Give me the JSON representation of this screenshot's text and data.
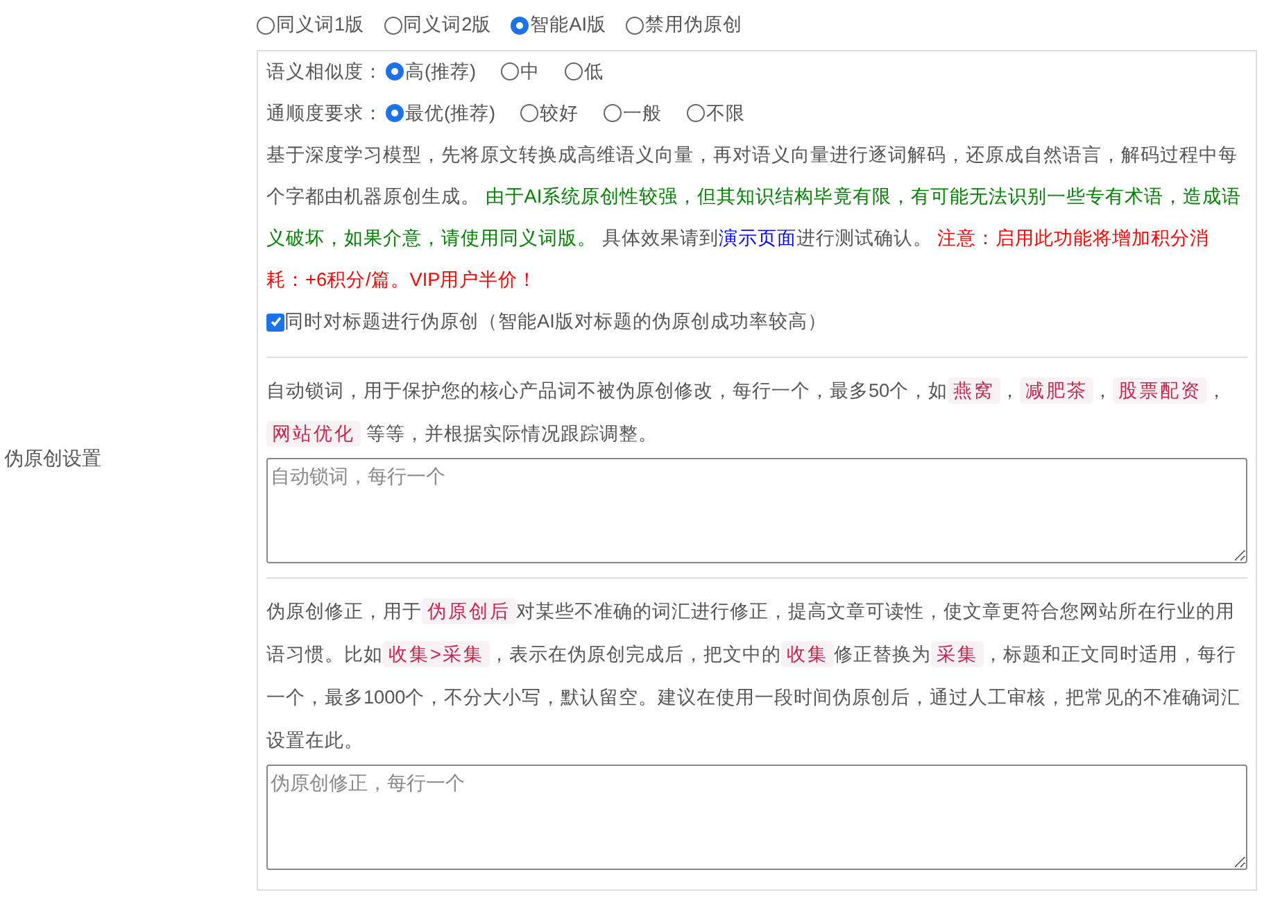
{
  "side_label": "伪原创设置",
  "modes": [
    {
      "label": "同义词1版",
      "selected": false
    },
    {
      "label": "同义词2版",
      "selected": false
    },
    {
      "label": "智能AI版",
      "selected": true
    },
    {
      "label": "禁用伪原创",
      "selected": false
    }
  ],
  "option_groups": [
    {
      "label": "语义相似度：",
      "options": [
        {
          "label": "高(推荐)",
          "selected": true
        },
        {
          "label": "中",
          "selected": false
        },
        {
          "label": "低",
          "selected": false
        }
      ]
    },
    {
      "label": "通顺度要求：",
      "options": [
        {
          "label": "最优(推荐)",
          "selected": true
        },
        {
          "label": "较好",
          "selected": false
        },
        {
          "label": "一般",
          "selected": false
        },
        {
          "label": "不限",
          "selected": false
        }
      ]
    }
  ],
  "ai_note": [
    {
      "kind": "text",
      "text": "基于深度学习模型，先将原文转换成高维语义向量，再对语义向量进行逐词解码，还原成自然语言，解码过程中每个字都由机器原创生成。 "
    },
    {
      "kind": "green",
      "text": "由于AI系统原创性较强，但其知识结构毕竟有限，有可能无法识别一些专有术语，造成语义破坏，如果介意，请使用同义词版。"
    },
    {
      "kind": "text",
      "text": " 具体效果请到"
    },
    {
      "kind": "link",
      "text": "演示页面"
    },
    {
      "kind": "text",
      "text": "进行测试确认。 "
    },
    {
      "kind": "red",
      "text": "注意：启用此功能将增加积分消耗：+6积分/篇。VIP用户半价！"
    }
  ],
  "title_option": {
    "label": "同时对标题进行伪原创（智能AI版对标题的伪原创成功率较高）",
    "checked": true
  },
  "sections": [
    {
      "note": [
        {
          "kind": "text",
          "text": "自动锁词，用于保护您的核心产品词不被伪原创修改，每行一个，最多50个，如"
        },
        {
          "kind": "tag",
          "text": "燕窝"
        },
        {
          "kind": "text",
          "text": "，"
        },
        {
          "kind": "tag",
          "text": "减肥茶"
        },
        {
          "kind": "text",
          "text": "，"
        },
        {
          "kind": "tag",
          "text": "股票配资"
        },
        {
          "kind": "text",
          "text": "，"
        },
        {
          "kind": "tag",
          "text": "网站优化"
        },
        {
          "kind": "text",
          "text": " 等等，并根据实际情况跟踪调整。"
        }
      ],
      "placeholder": "自动锁词，每行一个"
    },
    {
      "note": [
        {
          "kind": "text",
          "text": "伪原创修正，用于"
        },
        {
          "kind": "tag",
          "text": "伪原创后"
        },
        {
          "kind": "text",
          "text": "对某些不准确的词汇进行修正，提高文章可读性，使文章更符合您网站所在行业的用语习惯。比如"
        },
        {
          "kind": "tag",
          "text": "收集>采集"
        },
        {
          "kind": "text",
          "text": "，表示在伪原创完成后，把文中的"
        },
        {
          "kind": "tag",
          "text": "收集"
        },
        {
          "kind": "text",
          "text": "修正替换为"
        },
        {
          "kind": "tag",
          "text": "采集"
        },
        {
          "kind": "text",
          "text": "，标题和正文同时适用，每行一个，最多1000个，不分大小写，默认留空。建议在使用一段时间伪原创后，通过人工审核，把常见的不准确词汇设置在此。"
        }
      ],
      "placeholder": "伪原创修正，每行一个"
    }
  ]
}
